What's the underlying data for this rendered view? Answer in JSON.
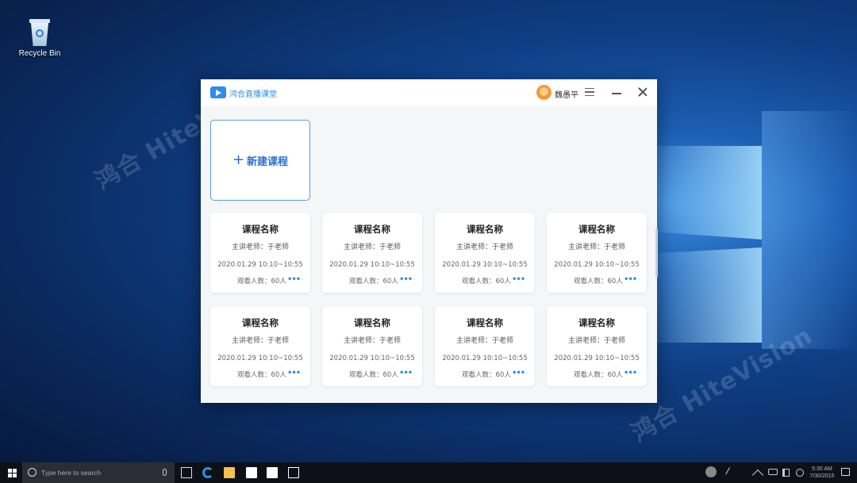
{
  "desktop": {
    "recycle_bin_label": "Recycle Bin",
    "watermark": "鸿合 HiteVision"
  },
  "app": {
    "title": "鸿合直播课堂",
    "user_name": "魏愚平",
    "new_course_plus": "+",
    "new_course_label": "新建课程",
    "more_glyph": "•••",
    "cards": [
      {
        "title": "课程名称",
        "teacher": "主讲老师：于老师",
        "time": "2020.01.29  10:10~10:55",
        "views": "观看人数：60人"
      },
      {
        "title": "课程名称",
        "teacher": "主讲老师：于老师",
        "time": "2020.01.29  10:10~10:55",
        "views": "观看人数：60人"
      },
      {
        "title": "课程名称",
        "teacher": "主讲老师：于老师",
        "time": "2020.01.29  10:10~10:55",
        "views": "观看人数：60人"
      },
      {
        "title": "课程名称",
        "teacher": "主讲老师：于老师",
        "time": "2020.01.29  10:10~10:55",
        "views": "观看人数：60人"
      },
      {
        "title": "课程名称",
        "teacher": "主讲老师：于老师",
        "time": "2020.01.29  10:10~10:55",
        "views": "观看人数：60人"
      },
      {
        "title": "课程名称",
        "teacher": "主讲老师：于老师",
        "time": "2020.01.29  10:10~10:55",
        "views": "观看人数：60人"
      },
      {
        "title": "课程名称",
        "teacher": "主讲老师：于老师",
        "time": "2020.01.29  10:10~10:55",
        "views": "观看人数：60人"
      },
      {
        "title": "课程名称",
        "teacher": "主讲老师：于老师",
        "time": "2020.01.29  10:10~10:55",
        "views": "观看人数：60人"
      }
    ]
  },
  "taskbar": {
    "search_placeholder": "Type here to search",
    "time": "5:30 AM",
    "date": "7/30/2015"
  },
  "colors": {
    "accent": "#2d8cf0",
    "window_bg": "#f5f6f8"
  }
}
